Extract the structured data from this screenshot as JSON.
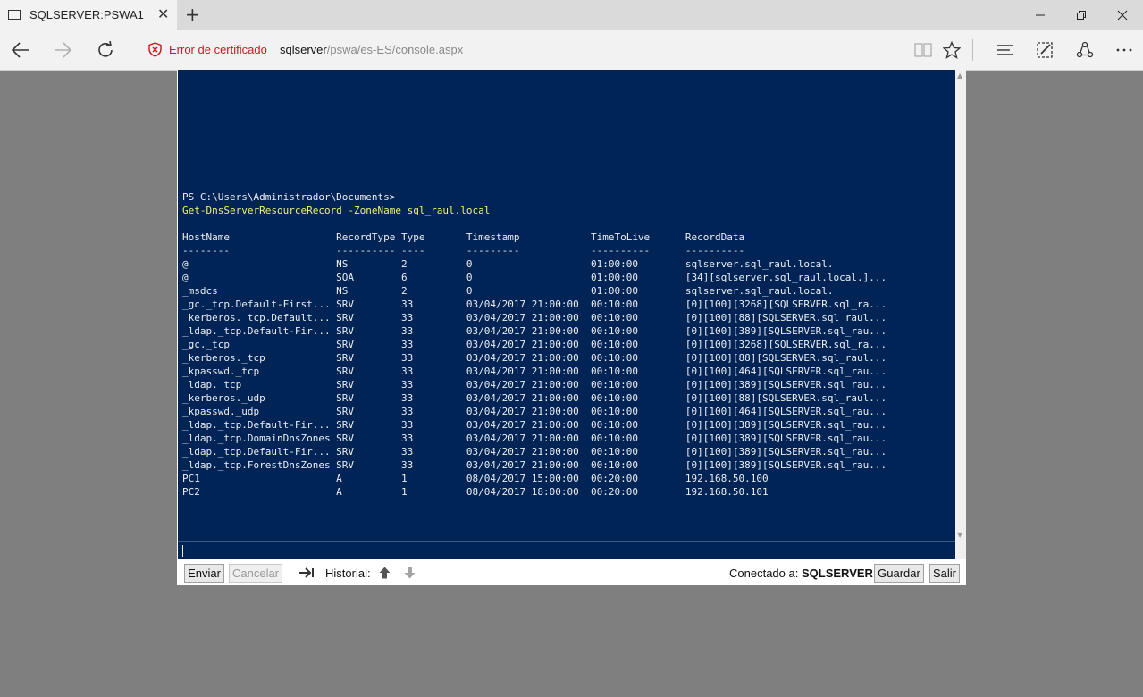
{
  "browser": {
    "tab_title": "SQLSERVER:PSWA1",
    "cert_error": "Error de certificado",
    "url_host": "sqlserver",
    "url_path": "/pswa/es-ES/console.aspx"
  },
  "console": {
    "lines": [
      {
        "cls": "",
        "text": "PS C:\\Users\\Administrador\\Documents>"
      },
      {
        "cls": "cmd",
        "text": "Get-DnsServerResourceRecord -ZoneName sql_raul.local"
      },
      {
        "cls": "",
        "text": ""
      },
      {
        "cls": "",
        "text": "HostName                  RecordType Type       Timestamp            TimeToLive      RecordData"
      },
      {
        "cls": "",
        "text": "--------                  ---------- ----       ---------            ----------      ----------"
      },
      {
        "cls": "",
        "text": "@                         NS         2          0                    01:00:00        sqlserver.sql_raul.local."
      },
      {
        "cls": "",
        "text": "@                         SOA        6          0                    01:00:00        [34][sqlserver.sql_raul.local.]..."
      },
      {
        "cls": "",
        "text": "_msdcs                    NS         2          0                    01:00:00        sqlserver.sql_raul.local."
      },
      {
        "cls": "",
        "text": "_gc._tcp.Default-First... SRV        33         03/04/2017 21:00:00  00:10:00        [0][100][3268][SQLSERVER.sql_ra..."
      },
      {
        "cls": "",
        "text": "_kerberos._tcp.Default... SRV        33         03/04/2017 21:00:00  00:10:00        [0][100][88][SQLSERVER.sql_raul..."
      },
      {
        "cls": "",
        "text": "_ldap._tcp.Default-Fir... SRV        33         03/04/2017 21:00:00  00:10:00        [0][100][389][SQLSERVER.sql_rau..."
      },
      {
        "cls": "",
        "text": "_gc._tcp                  SRV        33         03/04/2017 21:00:00  00:10:00        [0][100][3268][SQLSERVER.sql_ra..."
      },
      {
        "cls": "",
        "text": "_kerberos._tcp            SRV        33         03/04/2017 21:00:00  00:10:00        [0][100][88][SQLSERVER.sql_raul..."
      },
      {
        "cls": "",
        "text": "_kpasswd._tcp             SRV        33         03/04/2017 21:00:00  00:10:00        [0][100][464][SQLSERVER.sql_rau..."
      },
      {
        "cls": "",
        "text": "_ldap._tcp                SRV        33         03/04/2017 21:00:00  00:10:00        [0][100][389][SQLSERVER.sql_rau..."
      },
      {
        "cls": "",
        "text": "_kerberos._udp            SRV        33         03/04/2017 21:00:00  00:10:00        [0][100][88][SQLSERVER.sql_raul..."
      },
      {
        "cls": "",
        "text": "_kpasswd._udp             SRV        33         03/04/2017 21:00:00  00:10:00        [0][100][464][SQLSERVER.sql_rau..."
      },
      {
        "cls": "",
        "text": "_ldap._tcp.Default-Fir... SRV        33         03/04/2017 21:00:00  00:10:00        [0][100][389][SQLSERVER.sql_rau..."
      },
      {
        "cls": "",
        "text": "_ldap._tcp.DomainDnsZones SRV        33         03/04/2017 21:00:00  00:10:00        [0][100][389][SQLSERVER.sql_rau..."
      },
      {
        "cls": "",
        "text": "_ldap._tcp.Default-Fir... SRV        33         03/04/2017 21:00:00  00:10:00        [0][100][389][SQLSERVER.sql_rau..."
      },
      {
        "cls": "",
        "text": "_ldap._tcp.ForestDnsZones SRV        33         03/04/2017 21:00:00  00:10:00        [0][100][389][SQLSERVER.sql_rau..."
      },
      {
        "cls": "",
        "text": "PC1                       A          1          08/04/2017 15:00:00  00:20:00        192.168.50.100"
      },
      {
        "cls": "",
        "text": "PC2                       A          1          08/04/2017 18:00:00  00:20:00        192.168.50.101"
      },
      {
        "cls": "",
        "text": ""
      },
      {
        "cls": "",
        "text": ""
      },
      {
        "cls": "",
        "text": ""
      },
      {
        "cls": "",
        "text": "PS C:\\Users\\Administrador\\Documents>"
      }
    ]
  },
  "toolbar": {
    "send_label": "Enviar",
    "cancel_label": "Cancelar",
    "history_label": "Historial:",
    "connected_label": "Conectado a:",
    "connected_host": "SQLSERVER",
    "save_label": "Guardar",
    "exit_label": "Salir"
  }
}
